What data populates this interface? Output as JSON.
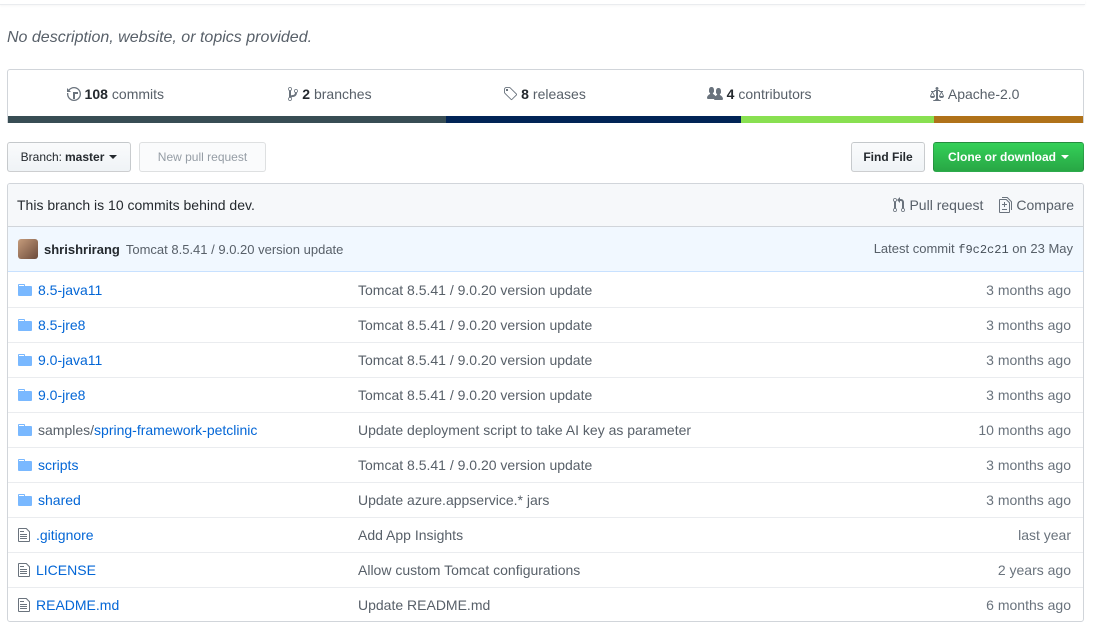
{
  "description": "No description, website, or topics provided.",
  "summary": {
    "commits": {
      "count": "108",
      "label": "commits"
    },
    "branches": {
      "count": "2",
      "label": "branches"
    },
    "releases": {
      "count": "8",
      "label": "releases"
    },
    "contributors": {
      "count": "4",
      "label": "contributors"
    },
    "license": "Apache-2.0"
  },
  "language_bar_colors": [
    "#384d54",
    "#012456",
    "#89e051",
    "#b07219"
  ],
  "toolbar": {
    "branch_prefix": "Branch:",
    "branch_name": "master",
    "new_pr_label": "New pull request",
    "find_file_label": "Find File",
    "clone_label": "Clone or download"
  },
  "branch_info": {
    "message": "This branch is 10 commits behind dev.",
    "pull_request_label": "Pull request",
    "compare_label": "Compare"
  },
  "latest_commit": {
    "author": "shrishrirang",
    "message": "Tomcat 8.5.41 / 9.0.20 version update",
    "prefix": "Latest commit",
    "sha": "f9c2c21",
    "date": "on 23 May"
  },
  "files": [
    {
      "type": "dir",
      "prefix": "",
      "name": "8.5-java11",
      "message": "Tomcat 8.5.41 / 9.0.20 version update",
      "age": "3 months ago"
    },
    {
      "type": "dir",
      "prefix": "",
      "name": "8.5-jre8",
      "message": "Tomcat 8.5.41 / 9.0.20 version update",
      "age": "3 months ago"
    },
    {
      "type": "dir",
      "prefix": "",
      "name": "9.0-java11",
      "message": "Tomcat 8.5.41 / 9.0.20 version update",
      "age": "3 months ago"
    },
    {
      "type": "dir",
      "prefix": "",
      "name": "9.0-jre8",
      "message": "Tomcat 8.5.41 / 9.0.20 version update",
      "age": "3 months ago"
    },
    {
      "type": "dir",
      "prefix": "samples/",
      "name": "spring-framework-petclinic",
      "message": "Update deployment script to take AI key as parameter",
      "age": "10 months ago"
    },
    {
      "type": "dir",
      "prefix": "",
      "name": "scripts",
      "message": "Tomcat 8.5.41 / 9.0.20 version update",
      "age": "3 months ago"
    },
    {
      "type": "dir",
      "prefix": "",
      "name": "shared",
      "message": "Update azure.appservice.* jars",
      "age": "3 months ago"
    },
    {
      "type": "file",
      "prefix": "",
      "name": ".gitignore",
      "message": "Add App Insights",
      "age": "last year"
    },
    {
      "type": "file",
      "prefix": "",
      "name": "LICENSE",
      "message": "Allow custom Tomcat configurations",
      "age": "2 years ago"
    },
    {
      "type": "file",
      "prefix": "",
      "name": "README.md",
      "message": "Update README.md",
      "age": "6 months ago"
    }
  ]
}
